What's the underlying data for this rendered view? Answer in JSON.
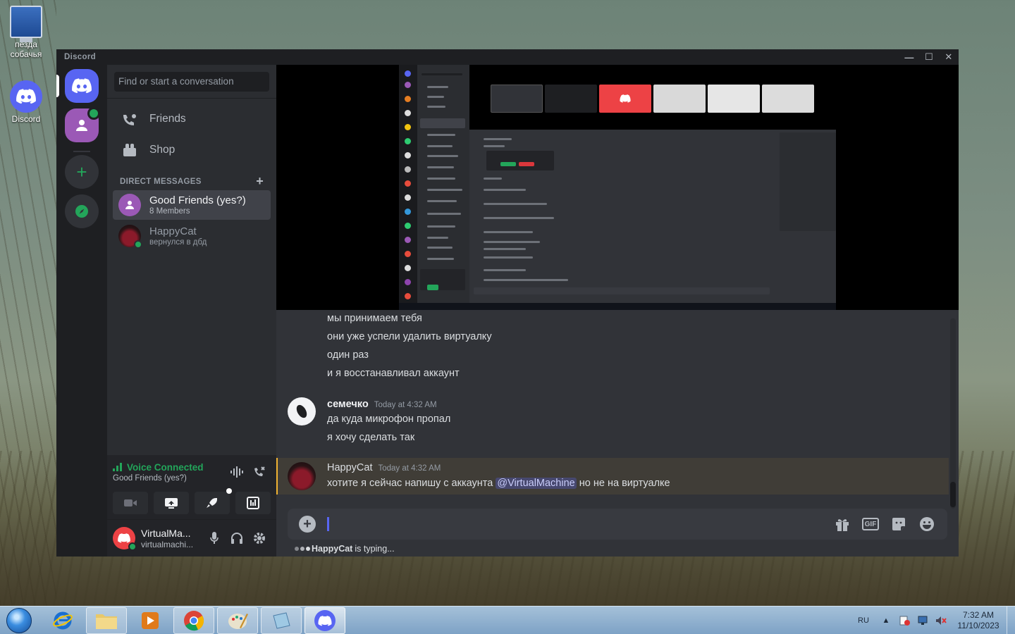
{
  "desktop": {
    "icons": [
      {
        "label": "пезда собачья"
      },
      {
        "label": "Discord"
      }
    ]
  },
  "window": {
    "title": "Discord",
    "controls": {
      "minimize": "—",
      "maximize": "☐",
      "close": "✕"
    }
  },
  "sidebar": {
    "search_placeholder": "Find or start a conversation",
    "nav": [
      {
        "label": "Friends",
        "icon": "friends-icon"
      },
      {
        "label": "Shop",
        "icon": "shop-icon"
      }
    ],
    "dm_header": "DIRECT MESSAGES",
    "dm_add": "+",
    "dms": [
      {
        "name": "Good Friends (yes?)",
        "sub": "8 Members",
        "active": true
      },
      {
        "name": "HappyCat",
        "sub": "вернулся в дбд",
        "active": false
      }
    ]
  },
  "voice": {
    "status": "Voice Connected",
    "channel": "Good Friends (yes?)"
  },
  "user": {
    "display_name": "VirtualMa...",
    "username": "virtualmachi..."
  },
  "messages": {
    "continued_lines": [
      "мы принимаем тебя",
      "они уже успели удалить виртуалку",
      "один раз",
      "и я восстанавливал аккаунт"
    ],
    "groups": [
      {
        "author": "семечко",
        "timestamp": "Today at 4:32 AM",
        "lines": [
          "да куда микрофон пропал",
          "я хочу сделать так"
        ]
      },
      {
        "author": "HappyCat",
        "timestamp": "Today at 4:32 AM",
        "text_before": "хотите я сейчас напишу с аккаунта",
        "mention": "@VirtualMachine",
        "text_after": "но не на виртуалке"
      }
    ]
  },
  "composer": {
    "add": "+",
    "gif": "GIF",
    "typing_user": "HappyCat",
    "typing_suffix": "is typing..."
  },
  "taskbar": {
    "lang": "RU",
    "time": "7:32 AM",
    "date": "11/10/2023"
  },
  "colors": {
    "discord_blurple": "#5865f2",
    "online_green": "#23a55a",
    "mention_bg": "#5865f24d",
    "highlight_border": "#f0b232"
  }
}
